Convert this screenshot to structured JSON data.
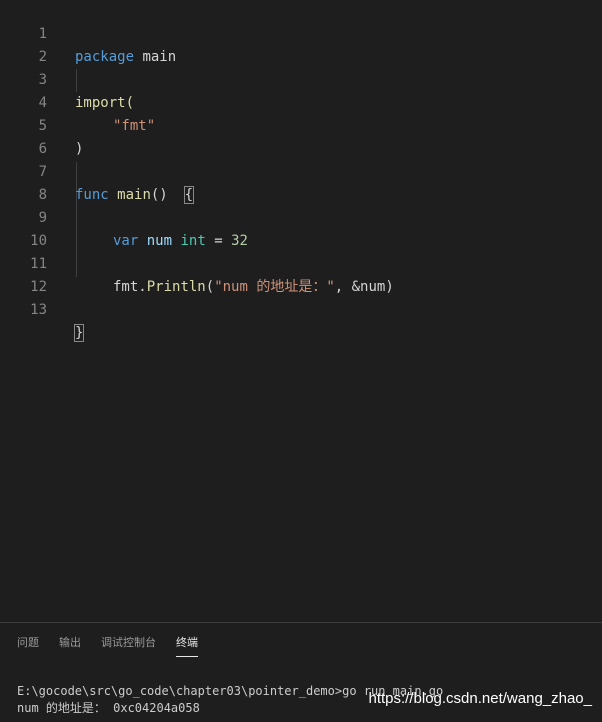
{
  "editor": {
    "line_numbers": [
      "1",
      "2",
      "3",
      "4",
      "5",
      "6",
      "7",
      "8",
      "9",
      "10",
      "11",
      "12",
      "13"
    ],
    "tokens": {
      "l1_package": "package",
      "l1_main": "main",
      "l3_import": "import(",
      "l4_fmt": "\"fmt\"",
      "l5_close": ")",
      "l7_func": "func",
      "l7_main": "main",
      "l7_parens": "()",
      "l7_brace": "{",
      "l9_var": "var",
      "l9_num": "num",
      "l9_int": "int",
      "l9_eq": "=",
      "l9_value": "32",
      "l11_fmt": "fmt",
      "l11_dot": ".",
      "l11_println": "Println",
      "l11_open": "(",
      "l11_str": "\"num 的地址是：\"",
      "l11_comma": ", ",
      "l11_arg": "&num",
      "l11_close": ")",
      "l13_brace": "}"
    }
  },
  "panel": {
    "tabs": [
      "问题",
      "输出",
      "调试控制台",
      "终端"
    ],
    "active_tab": "终端",
    "terminal_lines": [
      "E:\\gocode\\src\\go_code\\chapter03\\pointer_demo>go run main.go",
      "num 的地址是： 0xc04204a058"
    ]
  },
  "watermark": "https://blog.csdn.net/wang_zhao_",
  "colors": {
    "background": "#1e1e1e",
    "keyword": "#569cd6",
    "identifier": "#9cdcfe",
    "function": "#dcdcaa",
    "string": "#ce9178",
    "number": "#b5cea8",
    "type": "#4ec9b0",
    "line_number": "#858585"
  }
}
